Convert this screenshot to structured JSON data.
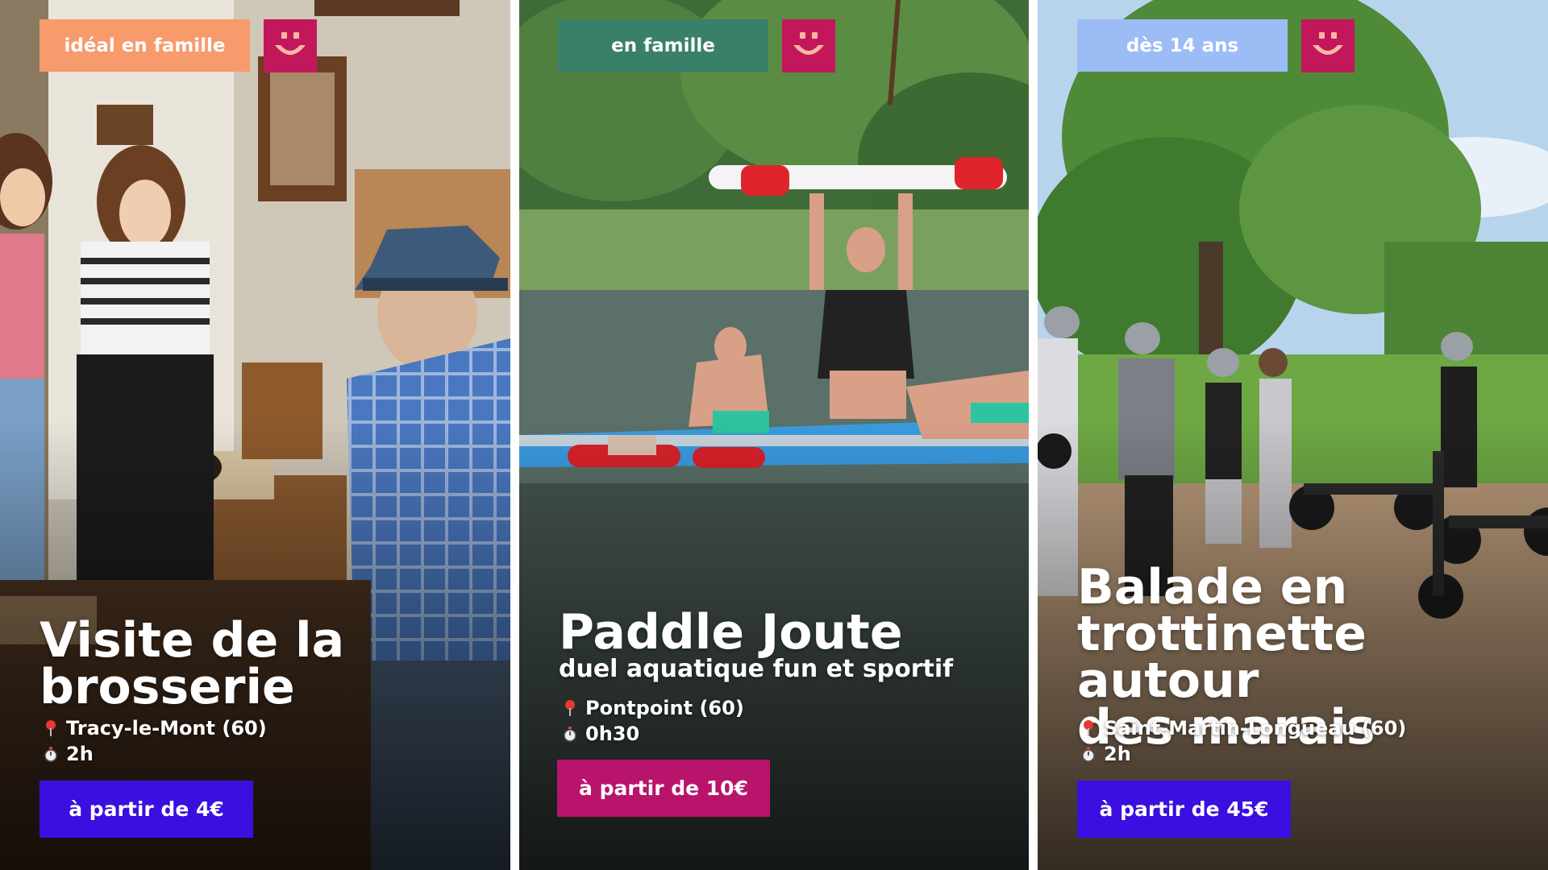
{
  "colors": {
    "logo_bg": "#c2185b",
    "logo_smile": "#f7b8a0",
    "price_blue": "#3a0fe0",
    "price_magenta": "#b8146c"
  },
  "cards": [
    {
      "tag": "idéal en famille",
      "tag_color": "#f79a6c",
      "title": "Visite de la\nbrosserie",
      "subtitle": "",
      "location_icon": "pin-icon",
      "location": "Tracy-le-Mont (60)",
      "duration_icon": "stopwatch-icon",
      "duration": "2h",
      "price": "à partir de 4€",
      "price_color": "#3a0fe0"
    },
    {
      "tag": "en famille",
      "tag_color": "#3a7f6a",
      "title": "Paddle Joute",
      "subtitle": "duel aquatique fun et sportif",
      "location_icon": "pin-icon",
      "location": "Pontpoint (60)",
      "duration_icon": "stopwatch-icon",
      "duration": "0h30",
      "price": "à partir de 10€",
      "price_color": "#b8146c"
    },
    {
      "tag": "dès 14 ans",
      "tag_color": "#9bbcf5",
      "title": "Balade en\ntrottinette autour\ndes marais",
      "subtitle": "",
      "location_icon": "pin-icon",
      "location": "Saint-Martin-Longueau (60)",
      "duration_icon": "stopwatch-icon",
      "duration": "2h",
      "price": "à partir de 45€",
      "price_color": "#3a0fe0"
    }
  ]
}
